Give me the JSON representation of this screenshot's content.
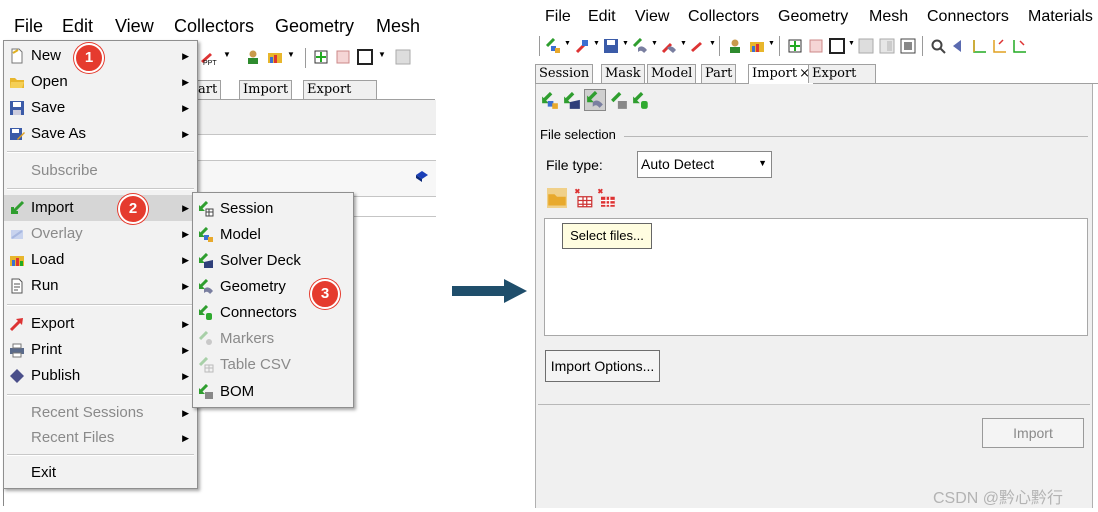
{
  "left": {
    "menubar": [
      "File",
      "Edit",
      "View",
      "Collectors",
      "Geometry",
      "Mesh"
    ],
    "tabs": [
      "art",
      "Import",
      "Export"
    ],
    "file_menu": [
      {
        "label": "New",
        "icon": "new-file-icon",
        "arrow": true,
        "disabled": false,
        "highlight": false
      },
      {
        "label": "Open",
        "icon": "folder-open-icon",
        "arrow": true,
        "disabled": false,
        "highlight": false
      },
      {
        "label": "Save",
        "icon": "save-disk-icon",
        "arrow": true,
        "disabled": false,
        "highlight": false
      },
      {
        "label": "Save As",
        "icon": "save-as-icon",
        "arrow": true,
        "disabled": false,
        "highlight": false
      },
      {
        "label": "Subscribe",
        "icon": "",
        "arrow": false,
        "disabled": true,
        "highlight": false
      },
      {
        "label": "Import",
        "icon": "import-arrow-icon",
        "arrow": true,
        "disabled": false,
        "highlight": true
      },
      {
        "label": "Overlay",
        "icon": "overlay-icon",
        "arrow": true,
        "disabled": true,
        "highlight": false
      },
      {
        "label": "Load",
        "icon": "load-icon",
        "arrow": true,
        "disabled": false,
        "highlight": false
      },
      {
        "label": "Run",
        "icon": "run-script-icon",
        "arrow": true,
        "disabled": false,
        "highlight": false
      },
      {
        "label": "Export",
        "icon": "export-arrow-icon",
        "arrow": true,
        "disabled": false,
        "highlight": false
      },
      {
        "label": "Print",
        "icon": "printer-icon",
        "arrow": true,
        "disabled": false,
        "highlight": false
      },
      {
        "label": "Publish",
        "icon": "publish-icon",
        "arrow": true,
        "disabled": false,
        "highlight": false
      },
      {
        "label": "Recent Sessions",
        "icon": "",
        "arrow": true,
        "disabled": true,
        "highlight": false
      },
      {
        "label": "Recent Files",
        "icon": "",
        "arrow": true,
        "disabled": true,
        "highlight": false
      },
      {
        "label": "Exit",
        "icon": "",
        "arrow": false,
        "disabled": false,
        "highlight": false
      }
    ],
    "import_submenu": [
      {
        "label": "Session",
        "icon": "import-session-icon",
        "disabled": false
      },
      {
        "label": "Model",
        "icon": "import-model-icon",
        "disabled": false
      },
      {
        "label": "Solver Deck",
        "icon": "import-solver-deck-icon",
        "disabled": false
      },
      {
        "label": "Geometry",
        "icon": "import-geometry-icon",
        "disabled": false
      },
      {
        "label": "Connectors",
        "icon": "import-connectors-icon",
        "disabled": false
      },
      {
        "label": "Markers",
        "icon": "import-markers-icon",
        "disabled": true
      },
      {
        "label": "Table CSV",
        "icon": "import-table-csv-icon",
        "disabled": true
      },
      {
        "label": "BOM",
        "icon": "import-bom-icon",
        "disabled": false
      }
    ],
    "badges": [
      "1",
      "2",
      "3"
    ],
    "ppt_label": "PPT"
  },
  "right": {
    "menubar": [
      "File",
      "Edit",
      "View",
      "Collectors",
      "Geometry",
      "Mesh",
      "Connectors",
      "Materials"
    ],
    "tabs": {
      "session": "Session",
      "mask": "Mask",
      "model": "Model",
      "part": "Part",
      "import": "Import",
      "import_close": "×",
      "export": "Export"
    },
    "file_selection_label": "File selection",
    "file_type_label": "File type:",
    "file_type_value": "Auto Detect",
    "select_files_button": "Select files...",
    "import_options_button": "Import Options...",
    "import_button": "Import"
  },
  "watermark": "CSDN @黔心黔行",
  "colors": {
    "badge_red": "#e53b2e",
    "arrow_blue": "#1f4e6b",
    "import_green": "#2f9e2f"
  }
}
